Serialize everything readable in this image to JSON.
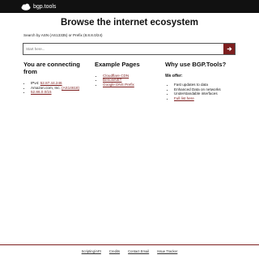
{
  "header": {
    "logo_text": "bgp.tools"
  },
  "hero": {
    "title": "Browse the internet ecosystem",
    "subtitle": "Search by ASN (AS13335) or Prefix (8.8.8.0/24)",
    "search_placeholder": "Start here..."
  },
  "connecting": {
    "heading": "You are connecting from",
    "ipv4_label": "IPv4: ",
    "ipv4_value": "52.87.44.246",
    "org_label": "Amazon.com, Inc. ",
    "asn_value": "(AS14618)",
    "prefix_value": "52.86.0.0/15"
  },
  "examples": {
    "heading": "Example Pages",
    "links": [
      "Cloudflare CDN",
      "BenoniNET",
      "Google DNS Prefix"
    ]
  },
  "why": {
    "heading": "Why use BGP.Tools?",
    "offer": "We offer:",
    "items": [
      "Fast updates to data",
      "Enhanced Data on networks",
      "Understandable interfaces"
    ],
    "full_list_link": "Full list here"
  },
  "footer": {
    "links": [
      "Scripting/API",
      "Credits",
      "Contact Email",
      "Issue Tracker"
    ]
  },
  "colors": {
    "accent": "#7d1f1f",
    "topbar": "#111111"
  }
}
